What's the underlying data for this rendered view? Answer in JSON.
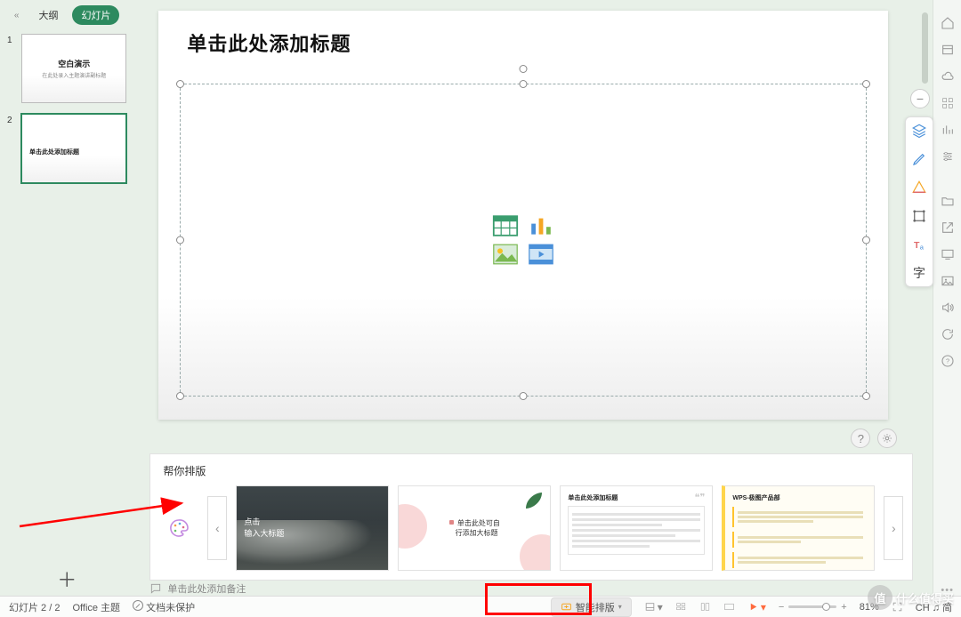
{
  "tabs": {
    "outline": "大纲",
    "slides": "幻灯片"
  },
  "thumbs": [
    {
      "n": "1",
      "t1": "空白演示",
      "t2": "在此处录入主题演讲副标题"
    },
    {
      "n": "2",
      "t1": "单击此处添加标题",
      "t2": ""
    }
  ],
  "slide": {
    "title_placeholder": "单击此处添加标题",
    "content_icons": [
      "table",
      "chart",
      "image",
      "media"
    ]
  },
  "slide_tools": [
    "layers",
    "pen",
    "shape",
    "crop",
    "text-style"
  ],
  "slide_tool_text": "字",
  "suggest": {
    "title": "帮你排版",
    "cards": {
      "c1": {
        "l1": "点击",
        "l2": "输入大标题",
        "l3": ""
      },
      "c2": {
        "bullet": "■",
        "l1": "单击此处可自",
        "l2": "行添加大标题"
      },
      "c3": {
        "hd": "单击此处添加标题"
      },
      "c4": {
        "hd": "WPS-极图产品部",
        "b1": "我们是致力于研究AI智能创作PPT的一个团队,我们潜心钻研幻灯片版布与创作思路,常觉进入工型智能的用户需求,不仅支持",
        "b2": "我们背后有金山办公软件30年的技术积累,以及一支富有研究精神的团队",
        "b3": "我们希望让每户觉得创作幻灯片不该是的负担,更专精的落地服务,我们抓住"
      }
    }
  },
  "notes": "单击此处添加备注",
  "smart_layout": "智能排版",
  "status": {
    "slide_pos": "幻灯片 2 / 2",
    "theme": "Office 主题",
    "protect": "文档未保护",
    "zoom": "81%",
    "ime": "CH ♫ 简"
  }
}
